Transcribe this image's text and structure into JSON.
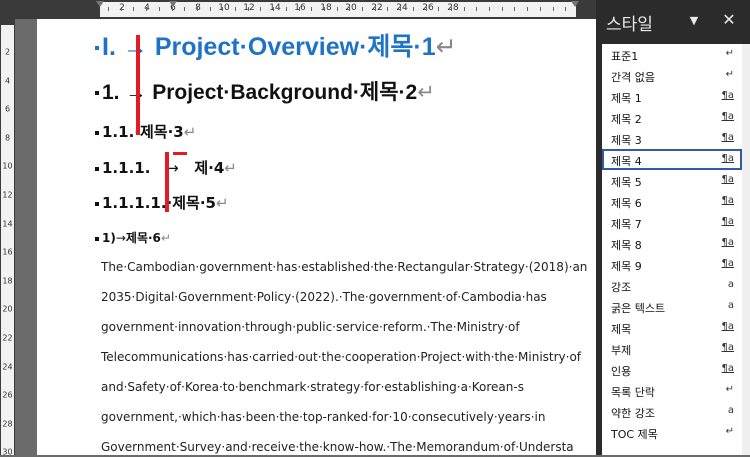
{
  "ruler": {
    "h_labels": [
      "2",
      "2",
      "4",
      "6",
      "8",
      "10",
      "12",
      "14",
      "16",
      "18",
      "20",
      "22",
      "24",
      "26",
      "28"
    ],
    "v_labels": [
      "2",
      "4",
      "6",
      "8",
      "10",
      "12",
      "14",
      "16",
      "18",
      "20",
      "22",
      "24",
      "26",
      "28",
      "30"
    ]
  },
  "doc": {
    "h1": {
      "num": "I.",
      "tab": "→",
      "text": "Project·Overview·제목·1",
      "mark": "↵"
    },
    "h2": {
      "num": "1.",
      "tab": "→",
      "text": "Project·Background·제목·2",
      "mark": "↵"
    },
    "h3": {
      "num": "1.1.",
      "text": "·제목·3",
      "mark": "↵"
    },
    "h4": {
      "num": "1.1.1.",
      "tab": "→",
      "text": "제·4",
      "mark": "↵"
    },
    "h5": {
      "num": "1.1.1.1.",
      "text": "·제목·5",
      "mark": "↵"
    },
    "h6": {
      "num": "1)",
      "tab": "→",
      "text": "제목·6",
      "mark": "↵"
    },
    "body": [
      "The·Cambodian·government·has·established·the·Rectangular·Strategy·(2018)·an",
      "2035·Digital·Government·Policy·(2022).·The·government·of·Cambodia·has",
      "government·innovation·through·public·service·reform.·The·Ministry·of",
      "Telecommunications·has·carried·out·the·cooperation·Project·with·the·Ministry·of",
      "and·Safety·of·Korea·to·benchmark·strategy·for·establishing·a·Korean-s",
      "government,·which·has·been·the·top-ranked·for·10·consecutively·years·in",
      "Government·Survey·and·receive·the·know-how.·The·Memorandum·of·Understa"
    ]
  },
  "pane": {
    "title": "스타일",
    "menu_icon": "▼",
    "close_icon": "✕",
    "styles": [
      {
        "name": "표준1",
        "icon": "↵"
      },
      {
        "name": "간격 없음",
        "icon": "↵"
      },
      {
        "name": "제목 1",
        "icon": "¶a"
      },
      {
        "name": "제목 2",
        "icon": "¶a"
      },
      {
        "name": "제목 3",
        "icon": "¶a"
      },
      {
        "name": "제목 4",
        "icon": "¶a",
        "selected": true
      },
      {
        "name": "제목 5",
        "icon": "¶a"
      },
      {
        "name": "제목 6",
        "icon": "¶a"
      },
      {
        "name": "제목 7",
        "icon": "¶a"
      },
      {
        "name": "제목 8",
        "icon": "¶a"
      },
      {
        "name": "제목 9",
        "icon": "¶a"
      },
      {
        "name": "강조",
        "icon": "a"
      },
      {
        "name": "굵은 텍스트",
        "icon": "a"
      },
      {
        "name": "제목",
        "icon": "¶a"
      },
      {
        "name": "부제",
        "icon": "¶a"
      },
      {
        "name": "인용",
        "icon": "¶a"
      },
      {
        "name": "목록 단락",
        "icon": "↵"
      },
      {
        "name": "약한 강조",
        "icon": "a"
      },
      {
        "name": "TOC 제목",
        "icon": "↵"
      }
    ]
  },
  "colors": {
    "heading1": "#1f73c7",
    "annotation": "#e51b23",
    "selection": "#2e5aa8"
  }
}
